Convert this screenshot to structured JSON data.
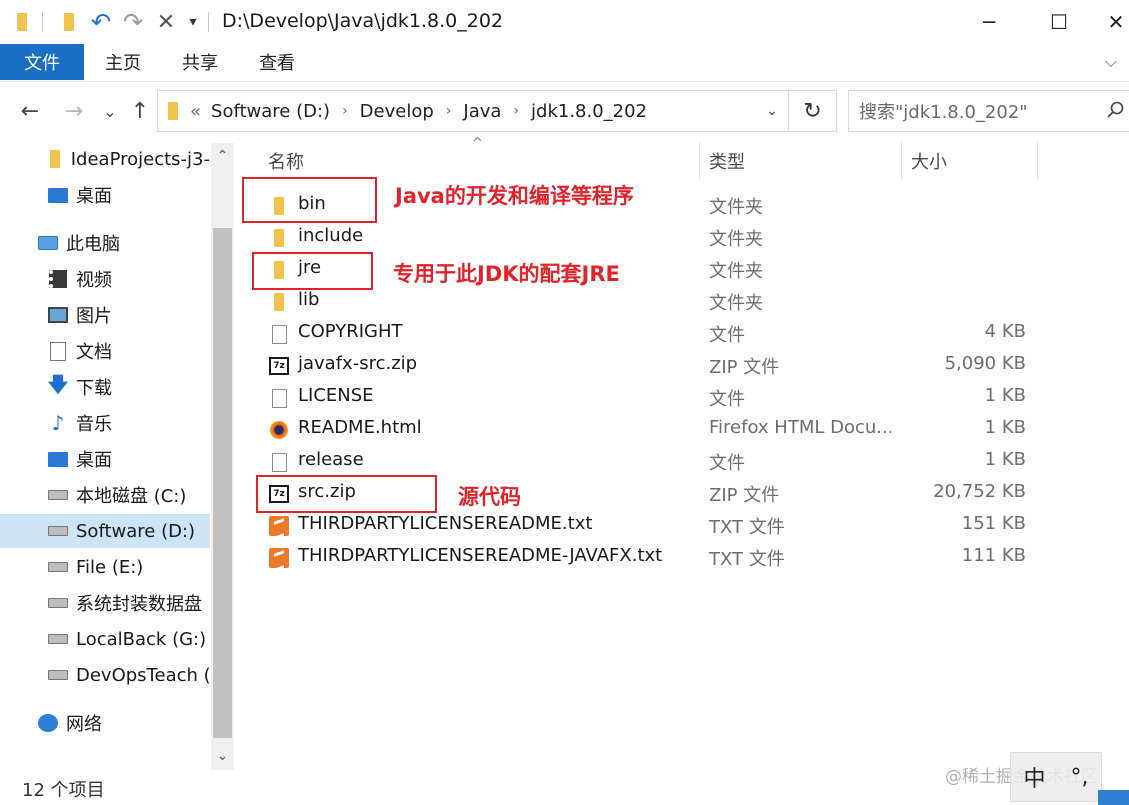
{
  "window": {
    "title": "D:\\Develop\\Java\\jdk1.8.0_202",
    "minimize_glyph": "─",
    "maximize_glyph": "☐",
    "close_glyph": "✕"
  },
  "quick_access": {
    "undo_glyph": "↶",
    "redo_glyph": "↷",
    "delete_glyph": "✕",
    "customize_glyph": "▾"
  },
  "ribbon": {
    "tabs": [
      "文件",
      "主页",
      "共享",
      "查看"
    ],
    "expand_glyph": "⌵"
  },
  "nav": {
    "back_glyph": "←",
    "forward_glyph": "→",
    "recent_glyph": "⌄",
    "up_glyph": "↑",
    "refresh_glyph": "↻",
    "address_dropdown_glyph": "⌄"
  },
  "address": {
    "overflow": "«",
    "crumbs": [
      "Software (D:)",
      "Develop",
      "Java",
      "jdk1.8.0_202"
    ],
    "separator": "›"
  },
  "search": {
    "placeholder": "搜索\"jdk1.8.0_202\"",
    "icon": "search-icon"
  },
  "sidebar": {
    "items": [
      {
        "label": "IdeaProjects-j3-",
        "icon": "folder-icon"
      },
      {
        "label": "桌面",
        "icon": "desktop-icon"
      },
      {
        "label": "此电脑",
        "icon": "computer-icon"
      },
      {
        "label": "视频",
        "icon": "video-icon"
      },
      {
        "label": "图片",
        "icon": "pictures-icon"
      },
      {
        "label": "文档",
        "icon": "documents-icon"
      },
      {
        "label": "下载",
        "icon": "download-icon",
        "glyph": "🡇"
      },
      {
        "label": "音乐",
        "icon": "music-icon",
        "glyph": "♪"
      },
      {
        "label": "桌面",
        "icon": "desktop-icon"
      },
      {
        "label": "本地磁盘 (C:)",
        "icon": "drive-icon"
      },
      {
        "label": "Software (D:)",
        "icon": "drive-icon",
        "selected": true
      },
      {
        "label": "File (E:)",
        "icon": "drive-icon"
      },
      {
        "label": "系统封装数据盘",
        "icon": "drive-icon"
      },
      {
        "label": "LocalBack (G:)",
        "icon": "drive-icon"
      },
      {
        "label": "DevOpsTeach (",
        "icon": "drive-icon"
      },
      {
        "label": "网络",
        "icon": "network-icon"
      }
    ],
    "scroll_up_glyph": "⌃",
    "scroll_down_glyph": "⌄"
  },
  "columns": {
    "name": "名称",
    "type": "类型",
    "size": "大小",
    "sort_glyph": "^"
  },
  "files": [
    {
      "name": "bin",
      "type": "文件夹",
      "size": "",
      "icon": "folder-icon"
    },
    {
      "name": "include",
      "type": "文件夹",
      "size": "",
      "icon": "folder-icon"
    },
    {
      "name": "jre",
      "type": "文件夹",
      "size": "",
      "icon": "folder-icon"
    },
    {
      "name": "lib",
      "type": "文件夹",
      "size": "",
      "icon": "folder-icon"
    },
    {
      "name": "COPYRIGHT",
      "type": "文件",
      "size": "4 KB",
      "icon": "file-icon"
    },
    {
      "name": "javafx-src.zip",
      "type": "ZIP 文件",
      "size": "5,090 KB",
      "icon": "7zip-icon"
    },
    {
      "name": "LICENSE",
      "type": "文件",
      "size": "1 KB",
      "icon": "file-icon"
    },
    {
      "name": "README.html",
      "type": "Firefox HTML Docu...",
      "size": "1 KB",
      "icon": "firefox-icon"
    },
    {
      "name": "release",
      "type": "文件",
      "size": "1 KB",
      "icon": "file-icon"
    },
    {
      "name": "src.zip",
      "type": "ZIP 文件",
      "size": "20,752 KB",
      "icon": "7zip-icon"
    },
    {
      "name": "THIRDPARTYLICENSEREADME.txt",
      "type": "TXT 文件",
      "size": "151 KB",
      "icon": "sublime-icon"
    },
    {
      "name": "THIRDPARTYLICENSEREADME-JAVAFX.txt",
      "type": "TXT 文件",
      "size": "111 KB",
      "icon": "sublime-icon"
    }
  ],
  "zip_icon_text": "7z",
  "annotations": {
    "bin": "Java的开发和编译等程序",
    "jre": "专用于此JDK的配套JRE",
    "src": "源代码"
  },
  "status": {
    "item_count": "12 个项目"
  },
  "watermark": "@稀土掘金技术社区",
  "ime": {
    "mode": "中",
    "punct": "°,"
  }
}
